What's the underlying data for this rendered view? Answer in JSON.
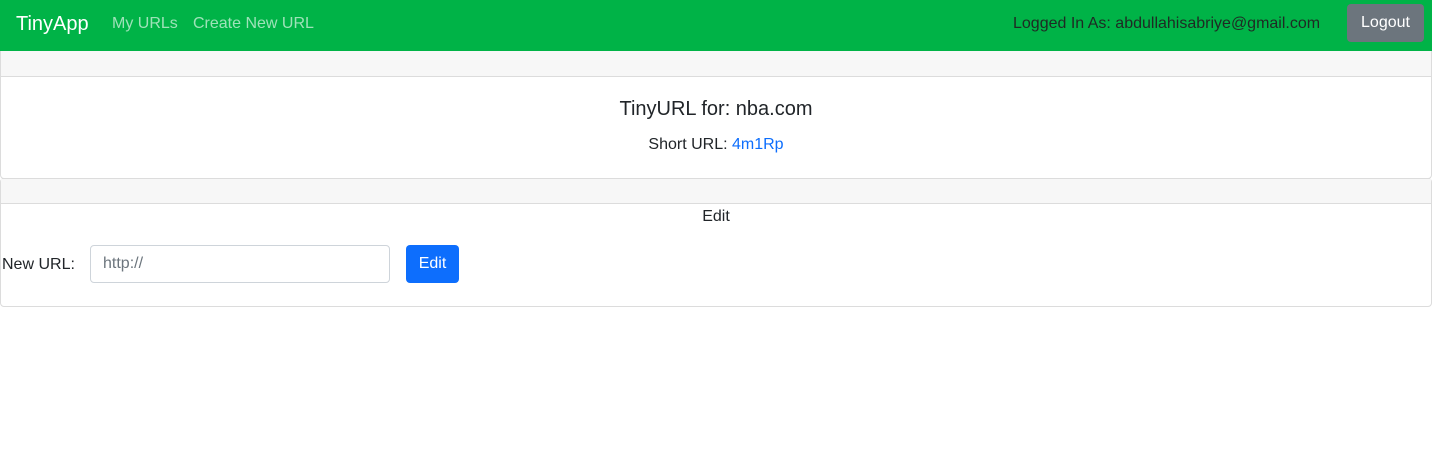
{
  "navbar": {
    "brand": "TinyApp",
    "links": [
      "My URLs",
      "Create New URL"
    ],
    "logged_in_text": "Logged In As: abdullahisabriye@gmail.com",
    "logout_label": "Logout",
    "background_color": "#00b347"
  },
  "url_card": {
    "title": "TinyURL for: nba.com",
    "short_url_label": "Short URL: ",
    "short_url_value": "4m1Rp"
  },
  "edit_card": {
    "heading": "Edit",
    "new_url_label": "New URL:",
    "input_placeholder": "http://",
    "input_value": "",
    "edit_button_label": "Edit"
  },
  "colors": {
    "link": "#0d6efd",
    "primary_button": "#0d6efd",
    "secondary_button": "#6c757d"
  }
}
